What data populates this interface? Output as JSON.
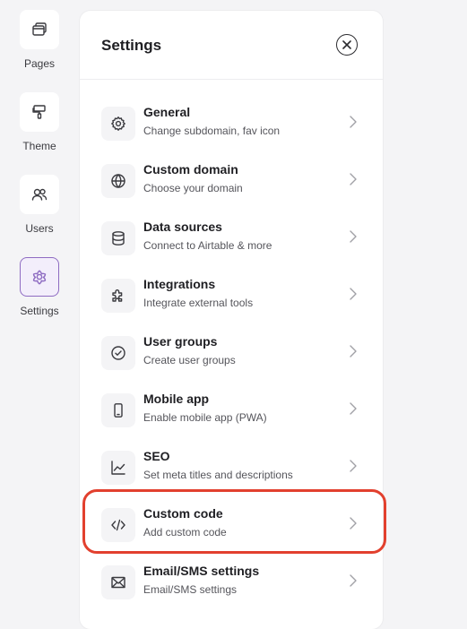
{
  "sidebar": {
    "items": [
      {
        "label": "Pages",
        "icon": "pages-icon",
        "active": false
      },
      {
        "label": "Theme",
        "icon": "paint-roller-icon",
        "active": false
      },
      {
        "label": "Users",
        "icon": "users-icon",
        "active": false
      },
      {
        "label": "Settings",
        "icon": "settings-flower-icon",
        "active": true
      }
    ]
  },
  "panel": {
    "title": "Settings",
    "close_icon": "close-icon",
    "items": [
      {
        "title": "General",
        "subtitle": "Change subdomain, fav icon",
        "icon": "gear-icon"
      },
      {
        "title": "Custom domain",
        "subtitle": "Choose your domain",
        "icon": "globe-icon"
      },
      {
        "title": "Data sources",
        "subtitle": "Connect to Airtable & more",
        "icon": "database-icon"
      },
      {
        "title": "Integrations",
        "subtitle": "Integrate external tools",
        "icon": "puzzle-icon"
      },
      {
        "title": "User groups",
        "subtitle": "Create user groups",
        "icon": "check-circle-icon"
      },
      {
        "title": "Mobile app",
        "subtitle": "Enable mobile app (PWA)",
        "icon": "mobile-icon"
      },
      {
        "title": "SEO",
        "subtitle": "Set meta titles and descriptions",
        "icon": "trend-chart-icon"
      },
      {
        "title": "Custom code",
        "subtitle": "Add custom code",
        "icon": "code-icon",
        "highlighted": true
      },
      {
        "title": "Email/SMS settings",
        "subtitle": "Email/SMS settings",
        "icon": "envelope-icon"
      }
    ]
  },
  "colors": {
    "background": "#f4f4f6",
    "panel": "#ffffff",
    "accent": "#8e6bc2",
    "highlight": "#e2402e"
  }
}
